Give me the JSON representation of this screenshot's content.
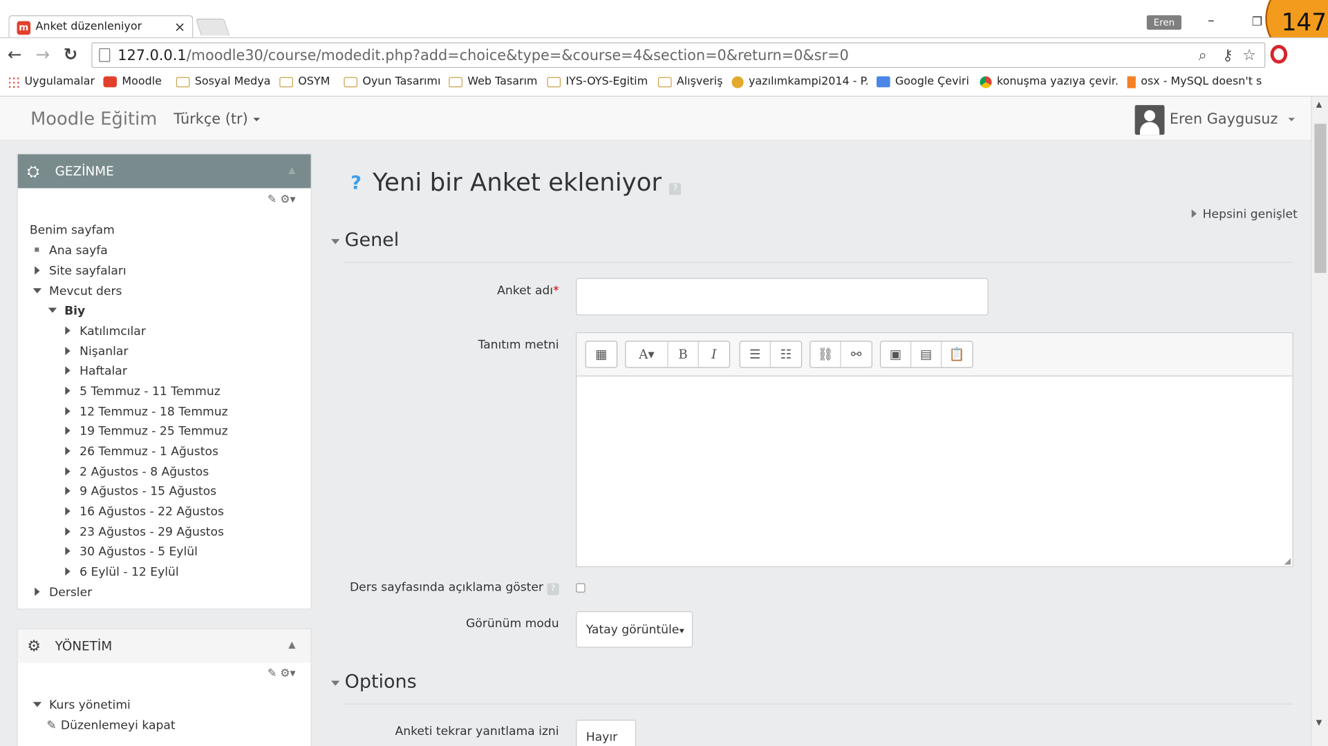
{
  "browser": {
    "tab_title": "Anket düzenleniyor",
    "tab_close": "×",
    "profile_badge": "Eren",
    "minimize": "–",
    "restore": "❐",
    "counter": "147",
    "back": "←",
    "forward": "→",
    "reload": "↻",
    "url_host": "127.0.0.1",
    "url_path": "/moodle30/course/modedit.php?add=choice&type=&course=4&section=0&return=0&sr=0",
    "zoom_icon": "zoom-icon",
    "key_icon": "key-icon",
    "star_icon": "star-icon",
    "accent": "#e2402c"
  },
  "bookmarks": [
    {
      "label": "Uygulamalar",
      "icon": "apps"
    },
    {
      "label": "Moodle",
      "icon": "moodle-fav"
    },
    {
      "label": "Sosyal Medya",
      "icon": "folder"
    },
    {
      "label": "OSYM",
      "icon": "folder"
    },
    {
      "label": "Oyun Tasarımı",
      "icon": "folder"
    },
    {
      "label": "Web Tasarım",
      "icon": "folder"
    },
    {
      "label": "IYS-OYS-Egitim",
      "icon": "folder"
    },
    {
      "label": "Alışveriş",
      "icon": "folder"
    },
    {
      "label": "yazılımkampi2014 - P.",
      "icon": "cat-fav"
    },
    {
      "label": "Google Çeviri",
      "icon": "gt-fav"
    },
    {
      "label": "konuşma yazıya çevir.",
      "icon": "chrome-fav"
    },
    {
      "label": "osx - MySQL doesn't s",
      "icon": "so-fav"
    }
  ],
  "navbar": {
    "brand": "Moodle Eğitim",
    "language": "Türkçe (tr)",
    "user": "Eren Gaygusuz"
  },
  "nav_block": {
    "title": "GEZİNME",
    "tools": "✎ ⚙▾",
    "items": [
      {
        "label": "Benim sayfam",
        "marker": "none"
      },
      {
        "label": "Ana sayfa",
        "marker": "dot"
      },
      {
        "label": "Site sayfaları",
        "marker": "right"
      },
      {
        "label": "Mevcut ders",
        "marker": "down"
      },
      {
        "label": "Biy",
        "marker": "down"
      },
      {
        "label": "Katılımcılar",
        "marker": "right"
      },
      {
        "label": "Nişanlar",
        "marker": "right"
      },
      {
        "label": "Haftalar",
        "marker": "right"
      },
      {
        "label": "5 Temmuz - 11 Temmuz",
        "marker": "right"
      },
      {
        "label": "12 Temmuz - 18 Temmuz",
        "marker": "right"
      },
      {
        "label": "19 Temmuz - 25 Temmuz",
        "marker": "right"
      },
      {
        "label": "26 Temmuz - 1 Ağustos",
        "marker": "right"
      },
      {
        "label": "2 Ağustos - 8 Ağustos",
        "marker": "right"
      },
      {
        "label": "9 Ağustos - 15 Ağustos",
        "marker": "right"
      },
      {
        "label": "16 Ağustos - 22 Ağustos",
        "marker": "right"
      },
      {
        "label": "23 Ağustos - 29 Ağustos",
        "marker": "right"
      },
      {
        "label": "30 Ağustos - 5 Eylül",
        "marker": "right"
      },
      {
        "label": "6 Eylül - 12 Eylül",
        "marker": "right"
      },
      {
        "label": "Dersler",
        "marker": "right"
      }
    ]
  },
  "admin_block": {
    "title": "YÖNETİM",
    "tools": "✎ ⚙▾",
    "items": [
      {
        "label": "Kurs yönetimi",
        "marker": "down"
      },
      {
        "label": "Düzenlemeyi kapat",
        "marker": "pencil"
      }
    ]
  },
  "main": {
    "help_icon": "?",
    "title": "Yeni bir Anket ekleniyor",
    "expand_all": "Hepsini genişlet",
    "section_general": "Genel",
    "field_name_label": "Anket adı",
    "required_mark": "*",
    "field_name_value": "",
    "field_intro_label": "Tanıtım metni",
    "field_showdesc_label": "Ders sayfasında açıklama göster",
    "field_display_label": "Görünüm modu",
    "field_display_value": "Yatay görüntüle",
    "section_options": "Options",
    "field_allowupdate_label": "Anketi tekrar yanıtlama izni",
    "field_allowupdate_value": "Hayır"
  },
  "editor_toolbar": {
    "groups": [
      [
        "toolbar-toggle-icon"
      ],
      [
        "font-size-icon",
        "bold-icon",
        "italic-icon"
      ],
      [
        "bullet-list-icon",
        "numbered-list-icon"
      ],
      [
        "link-icon",
        "unlink-icon"
      ],
      [
        "image-icon",
        "media-icon",
        "paste-icon"
      ]
    ],
    "glyphs": {
      "toolbar-toggle-icon": "▦",
      "font-size-icon": "A▾",
      "bold-icon": "B",
      "italic-icon": "I",
      "bullet-list-icon": "☰",
      "numbered-list-icon": "☷",
      "link-icon": "⛓",
      "unlink-icon": "⚯",
      "image-icon": "▣",
      "media-icon": "▤",
      "paste-icon": "📋"
    }
  }
}
